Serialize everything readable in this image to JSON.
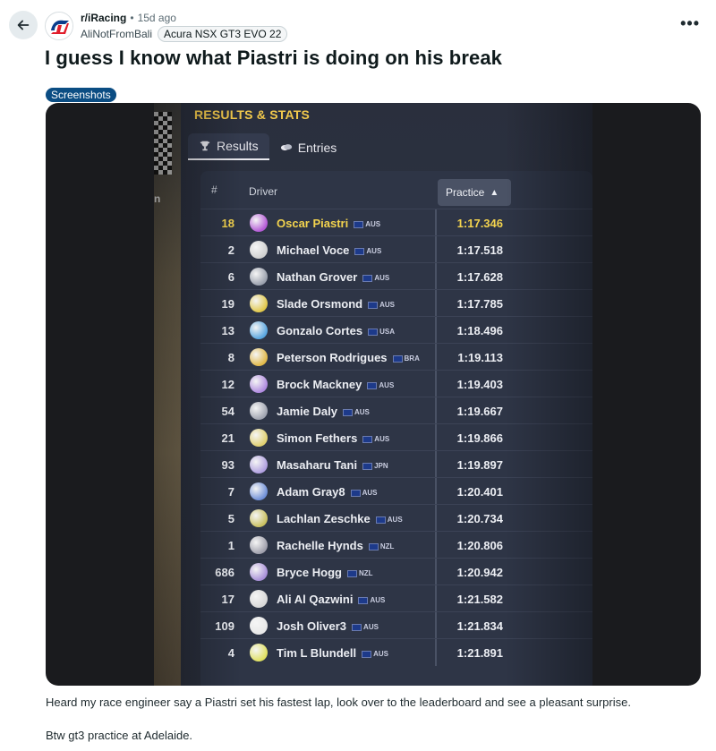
{
  "header": {
    "subreddit": "r/iRacing",
    "separator": "•",
    "age": "15d ago",
    "author": "AliNotFromBali",
    "user_flair": "Acura NSX GT3 EVO 22",
    "more": "•••"
  },
  "post": {
    "title": "I guess I know what Piastri is doing on his break",
    "flair": "Screenshots",
    "body_1": "Heard my race engineer say a Piastri set his fastest lap, look over to the leaderboard and see a pleasant surprise.",
    "body_2": "Btw gt3 practice at Adelaide."
  },
  "screenshot": {
    "section_title": "RESULTS & STATS",
    "tabs": [
      {
        "label": "Results",
        "icon": "trophy-icon",
        "active": true
      },
      {
        "label": "Entries",
        "icon": "tickets-icon",
        "active": false
      }
    ],
    "left_panel_char": "n",
    "columns": {
      "num": "#",
      "driver": "Driver",
      "practice": "Practice"
    },
    "rows": [
      {
        "num": "18",
        "driver": "Oscar Piastri",
        "country": "AUS",
        "time": "1:17.346",
        "leader": true
      },
      {
        "num": "2",
        "driver": "Michael Voce",
        "country": "AUS",
        "time": "1:17.518"
      },
      {
        "num": "6",
        "driver": "Nathan Grover",
        "country": "AUS",
        "time": "1:17.628"
      },
      {
        "num": "19",
        "driver": "Slade Orsmond",
        "country": "AUS",
        "time": "1:17.785"
      },
      {
        "num": "13",
        "driver": "Gonzalo Cortes",
        "country": "USA",
        "time": "1:18.496"
      },
      {
        "num": "8",
        "driver": "Peterson Rodrigues",
        "country": "BRA",
        "time": "1:19.113"
      },
      {
        "num": "12",
        "driver": "Brock Mackney",
        "country": "AUS",
        "time": "1:19.403"
      },
      {
        "num": "54",
        "driver": "Jamie Daly",
        "country": "AUS",
        "time": "1:19.667"
      },
      {
        "num": "21",
        "driver": "Simon Fethers",
        "country": "AUS",
        "time": "1:19.866"
      },
      {
        "num": "93",
        "driver": "Masaharu Tani",
        "country": "JPN",
        "time": "1:19.897"
      },
      {
        "num": "7",
        "driver": "Adam Gray8",
        "country": "AUS",
        "time": "1:20.401"
      },
      {
        "num": "5",
        "driver": "Lachlan Zeschke",
        "country": "AUS",
        "time": "1:20.734"
      },
      {
        "num": "1",
        "driver": "Rachelle Hynds",
        "country": "NZL",
        "time": "1:20.806"
      },
      {
        "num": "686",
        "driver": "Bryce Hogg",
        "country": "NZL",
        "time": "1:20.942"
      },
      {
        "num": "17",
        "driver": "Ali Al Qazwini",
        "country": "AUS",
        "time": "1:21.582"
      },
      {
        "num": "109",
        "driver": "Josh Oliver3",
        "country": "AUS",
        "time": "1:21.834"
      },
      {
        "num": "4",
        "driver": "Tim L Blundell",
        "country": "AUS",
        "time": "1:21.891"
      }
    ]
  },
  "colors": {
    "flair_bg": "#0b4d83",
    "leader_yellow": "#f3d34e",
    "panel_bg": "#2e3546"
  }
}
